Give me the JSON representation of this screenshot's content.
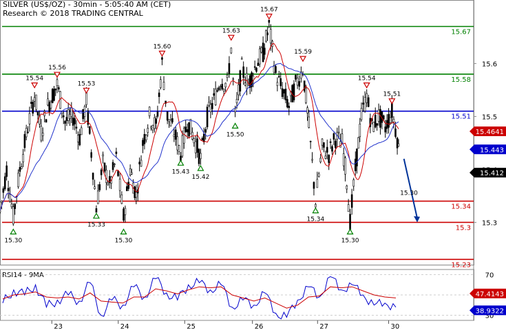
{
  "header": {
    "title": "SILVER (US$/OZ) - 30min - 5:05:40 AM (CET)",
    "credit": "Research © 2018 TRADING CENTRAL"
  },
  "chart_data": [
    {
      "type": "candlestick",
      "ylim": [
        15.22,
        15.72
      ],
      "y_ticks": [
        "15.6",
        "15.5",
        "15.4",
        "15.3"
      ],
      "x_ticks": [
        "23",
        "24",
        "25",
        "26",
        "27",
        "30"
      ],
      "levels": [
        {
          "value": 15.67,
          "label": "15.67",
          "color": "#008000"
        },
        {
          "value": 15.58,
          "label": "15.58",
          "color": "#008000"
        },
        {
          "value": 15.51,
          "label": "15.51",
          "color": "#0000cc"
        },
        {
          "value": 15.34,
          "label": "15.34",
          "color": "#cc0000"
        },
        {
          "value": 15.3,
          "label": "15.3",
          "color": "#cc0000"
        },
        {
          "value": 15.23,
          "label": "15.23",
          "color": "#cc0000"
        }
      ],
      "price_tags": [
        {
          "value": 15.4641,
          "label": "15.4641",
          "color": "#cc0000"
        },
        {
          "value": 15.443,
          "label": "15.443",
          "color": "#0000cc"
        },
        {
          "value": 15.412,
          "label": "15.412",
          "color": "#000000"
        }
      ],
      "highs": [
        {
          "time": 0.52,
          "value": 15.54,
          "label": "15.54"
        },
        {
          "time": 0.86,
          "value": 15.56,
          "label": "15.56"
        },
        {
          "time": 1.3,
          "value": 15.53,
          "label": "15.53"
        },
        {
          "time": 2.44,
          "value": 15.6,
          "label": "15.60"
        },
        {
          "time": 3.48,
          "value": 15.63,
          "label": "15.63"
        },
        {
          "time": 4.05,
          "value": 15.67,
          "label": "15.67"
        },
        {
          "time": 4.56,
          "value": 15.59,
          "label": "15.59"
        },
        {
          "time": 5.52,
          "value": 15.54,
          "label": "15.54"
        },
        {
          "time": 5.9,
          "value": 15.51,
          "label": "15.51"
        }
      ],
      "lows": [
        {
          "time": 0.2,
          "value": 15.3,
          "label": "15.30"
        },
        {
          "time": 1.45,
          "value": 15.33,
          "label": "15.33"
        },
        {
          "time": 1.86,
          "value": 15.3,
          "label": "15.30"
        },
        {
          "time": 2.72,
          "value": 15.43,
          "label": "15.43"
        },
        {
          "time": 3.02,
          "value": 15.42,
          "label": "15.42"
        },
        {
          "time": 3.54,
          "value": 15.5,
          "label": "15.50"
        },
        {
          "time": 4.75,
          "value": 15.34,
          "label": "15.34"
        },
        {
          "time": 5.27,
          "value": 15.3,
          "label": "15.30"
        }
      ],
      "projection": {
        "from": [
          6.08,
          15.42
        ],
        "to": [
          6.28,
          15.3
        ],
        "label": "15.30",
        "color": "#003399"
      },
      "price_path": [
        [
          0.0,
          15.32
        ],
        [
          0.1,
          15.4
        ],
        [
          0.2,
          15.31
        ],
        [
          0.3,
          15.4
        ],
        [
          0.42,
          15.48
        ],
        [
          0.52,
          15.54
        ],
        [
          0.62,
          15.47
        ],
        [
          0.72,
          15.52
        ],
        [
          0.86,
          15.56
        ],
        [
          0.98,
          15.49
        ],
        [
          1.1,
          15.5
        ],
        [
          1.2,
          15.46
        ],
        [
          1.3,
          15.53
        ],
        [
          1.4,
          15.4
        ],
        [
          1.45,
          15.33
        ],
        [
          1.55,
          15.41
        ],
        [
          1.65,
          15.37
        ],
        [
          1.75,
          15.42
        ],
        [
          1.86,
          15.31
        ],
        [
          1.96,
          15.4
        ],
        [
          2.05,
          15.35
        ],
        [
          2.15,
          15.45
        ],
        [
          2.25,
          15.5
        ],
        [
          2.35,
          15.48
        ],
        [
          2.44,
          15.6
        ],
        [
          2.52,
          15.5
        ],
        [
          2.62,
          15.47
        ],
        [
          2.72,
          15.43
        ],
        [
          2.82,
          15.49
        ],
        [
          2.92,
          15.46
        ],
        [
          3.02,
          15.42
        ],
        [
          3.12,
          15.5
        ],
        [
          3.22,
          15.53
        ],
        [
          3.32,
          15.57
        ],
        [
          3.42,
          15.56
        ],
        [
          3.48,
          15.63
        ],
        [
          3.54,
          15.5
        ],
        [
          3.64,
          15.59
        ],
        [
          3.74,
          15.56
        ],
        [
          3.86,
          15.6
        ],
        [
          3.96,
          15.62
        ],
        [
          4.05,
          15.67
        ],
        [
          4.15,
          15.58
        ],
        [
          4.25,
          15.55
        ],
        [
          4.35,
          15.52
        ],
        [
          4.45,
          15.56
        ],
        [
          4.56,
          15.59
        ],
        [
          4.65,
          15.48
        ],
        [
          4.75,
          15.34
        ],
        [
          4.85,
          15.44
        ],
        [
          4.95,
          15.43
        ],
        [
          5.05,
          15.46
        ],
        [
          5.15,
          15.45
        ],
        [
          5.22,
          15.38
        ],
        [
          5.27,
          15.3
        ],
        [
          5.35,
          15.4
        ],
        [
          5.44,
          15.5
        ],
        [
          5.52,
          15.54
        ],
        [
          5.6,
          15.48
        ],
        [
          5.7,
          15.5
        ],
        [
          5.8,
          15.48
        ],
        [
          5.9,
          15.51
        ],
        [
          5.98,
          15.46
        ],
        [
          6.02,
          15.42
        ]
      ]
    },
    {
      "type": "line",
      "title": "RSI14 - 9MA",
      "ylim": [
        25,
        75
      ],
      "y_ticks": [
        "70",
        "50",
        "30"
      ],
      "tags": [
        {
          "value": 47.4143,
          "label": "47.4143",
          "color": "#cc0000"
        },
        {
          "value": 38.9322,
          "label": "38.9322",
          "color": "#0000cc"
        }
      ],
      "series": [
        {
          "color": "#0000cc",
          "values": [
            42,
            55,
            50,
            60,
            38,
            45,
            50,
            44,
            62,
            30,
            45,
            40,
            58,
            48,
            66,
            52,
            45,
            60,
            62,
            55,
            60,
            38,
            45,
            40,
            52,
            32,
            28,
            45,
            58,
            48,
            68,
            55,
            60,
            50,
            40,
            42,
            38
          ]
        },
        {
          "color": "#cc0000",
          "values": [
            46,
            50,
            51,
            53,
            48,
            47,
            48,
            46,
            52,
            44,
            43,
            42,
            48,
            48,
            56,
            54,
            51,
            55,
            58,
            57,
            58,
            50,
            47,
            44,
            47,
            42,
            37,
            40,
            48,
            49,
            58,
            57,
            58,
            54,
            50,
            48,
            47
          ]
        }
      ]
    }
  ]
}
